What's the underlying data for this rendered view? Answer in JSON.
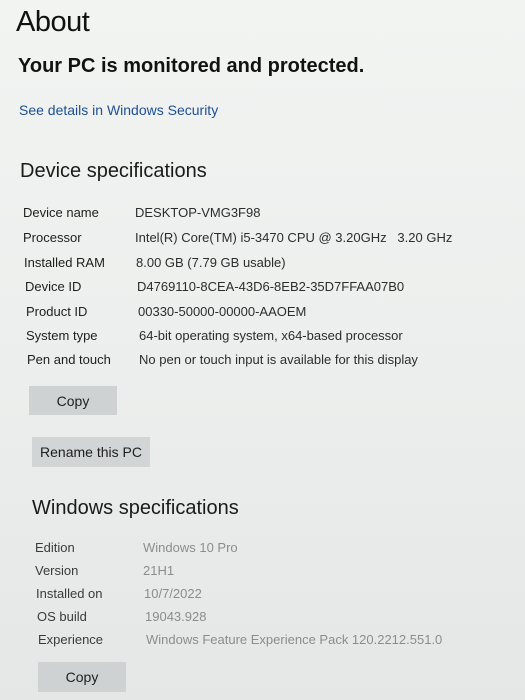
{
  "about": {
    "title": "About",
    "status": "Your PC is monitored and protected.",
    "security_link": "See details in Windows Security"
  },
  "device_specs": {
    "heading": "Device specifications",
    "rows": [
      {
        "label": "Device name",
        "value": "DESKTOP-VMG3F98"
      },
      {
        "label": "Processor",
        "value": "Intel(R) Core(TM) i5-3470 CPU @ 3.20GHz   3.20 GHz"
      },
      {
        "label": "Installed RAM",
        "value": "8.00 GB (7.79 GB usable)"
      },
      {
        "label": "Device ID",
        "value": "D4769110-8CEA-43D6-8EB2-35D7FFAA07B0"
      },
      {
        "label": "Product ID",
        "value": "00330-50000-00000-AAOEM"
      },
      {
        "label": "System type",
        "value": "64-bit operating system, x64-based processor"
      },
      {
        "label": "Pen and touch",
        "value": "No pen or touch input is available for this display"
      }
    ],
    "copy_label": "Copy",
    "rename_label": "Rename this PC"
  },
  "windows_specs": {
    "heading": "Windows specifications",
    "rows": [
      {
        "label": "Edition",
        "value": "Windows 10 Pro"
      },
      {
        "label": "Version",
        "value": "21H1"
      },
      {
        "label": "Installed on",
        "value": "10/7/2022"
      },
      {
        "label": "OS build",
        "value": "19043.928"
      },
      {
        "label": "Experience",
        "value": "Windows Feature Experience Pack 120.2212.551.0"
      }
    ],
    "copy_label": "Copy"
  }
}
